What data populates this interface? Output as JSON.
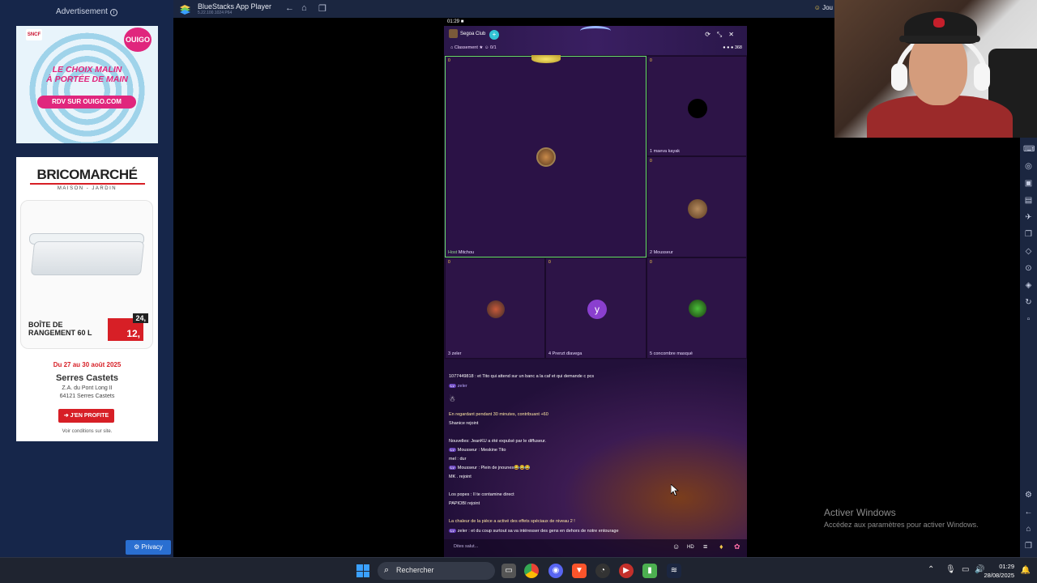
{
  "ads": {
    "label": "Advertisement",
    "ouigo": {
      "sncf": "SNCF",
      "brand": "OUIGO",
      "slogan_line1": "LE CHOIX MALIN",
      "slogan_line2": "À PORTÉE DE MAIN",
      "cta": "RDV SUR OUIGO.COM"
    },
    "brico": {
      "logo": "BRICOMARCHÉ",
      "sub": "MAISON - JARDIN",
      "product_line1": "BOÎTE DE",
      "product_line2": "RANGEMENT 60 L",
      "old_price": "24,",
      "price": "12,",
      "dates": "Du 27 au 30 août 2025",
      "store": "Serres Castets",
      "addr1": "Z.A. du Pont Long II",
      "addr2": "64121 Serres Castets",
      "cta": "J'EN PROFITE",
      "conditions": "Voir conditions sur site."
    },
    "privacy": "Privacy"
  },
  "bluestacks": {
    "title": "BlueStacks App Player",
    "version": "5.22.100.1024  P64",
    "right_text": "Jou"
  },
  "game": {
    "status_time": "01:29",
    "club": "Segoa Club",
    "rank": "Classement",
    "rank_count": "0/1",
    "viewers": "368",
    "tiles": [
      {
        "num": "0",
        "name": "Mitchou"
      },
      {
        "num": "0",
        "name": "maeva kayak"
      },
      {
        "num": "0",
        "name": "Mousseur"
      },
      {
        "num": "0",
        "name": "zeler"
      },
      {
        "num": "0",
        "name": "Prenzt dlavega"
      },
      {
        "num": "0",
        "name": "concombre masqué"
      }
    ],
    "y_avatar": "y",
    "chat": [
      {
        "text": "1077449818 : et Tito qui attend sur un banc a la caf  et qui demande c pcs"
      },
      {
        "text": "zeler"
      },
      {
        "text": "En regardant pendant 30 minutes, contribuant  +60"
      },
      {
        "text": "Shanice rejoint"
      },
      {
        "text": "Nouvelles: JeanKU a été expulsé par le diffuseur."
      },
      {
        "text": "Mousseur : Meskine Tito"
      },
      {
        "text": "mel : dur"
      },
      {
        "text": "Mousseur : Plein de jnounes😂😂😂"
      },
      {
        "text": "MK . rejoint"
      },
      {
        "text": "Los popes : Il te contamine direct"
      },
      {
        "text": "PAPIOBI rejoint"
      },
      {
        "text": "La chaleur de la pièce a activé des effets spéciaux de niveau 2 !"
      },
      {
        "text": "zeler : et du coup surtout sa va intéresser des gens en dehors de notre entourage"
      }
    ],
    "input_placeholder": "Dites salut..."
  },
  "activate": {
    "title": "Activer Windows",
    "subtitle": "Accédez aux paramètres pour activer Windows."
  },
  "taskbar": {
    "search": "Rechercher",
    "time": "01:29",
    "date": "28/08/2025"
  }
}
